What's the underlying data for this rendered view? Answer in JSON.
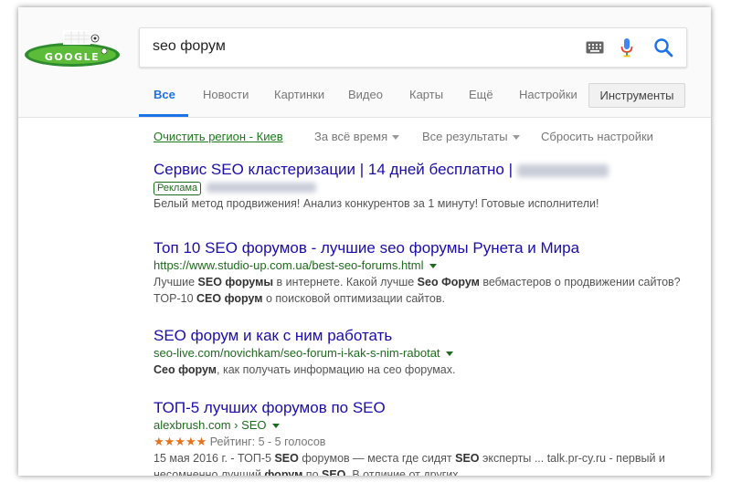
{
  "search": {
    "query": "seo форум"
  },
  "tabs": [
    {
      "label": "Все",
      "active": true
    },
    {
      "label": "Новости"
    },
    {
      "label": "Картинки"
    },
    {
      "label": "Видео"
    },
    {
      "label": "Карты"
    },
    {
      "label": "Ещё"
    },
    {
      "label": "Настройки"
    }
  ],
  "tools_button": "Инструменты",
  "toolsbar": {
    "region": "Очистить регион - Киев",
    "time": "За всё время",
    "results": "Все результаты",
    "reset": "Сбросить настройки"
  },
  "results": [
    {
      "title": "Сервис SEO кластеризации | 14 дней бесплатно |",
      "ad_badge": "Реклама",
      "snippet": "Белый метод продвижения! Анализ конкурентов за 1 минуту! Готовые исполнители!"
    },
    {
      "title_a": "Топ 10 SEO форумов",
      "title_b": " - лучшие seo форумы Рунета и Мира",
      "url": "https://www.studio-up.com.ua/best-seo-forums.html",
      "snip1_a": "Лучшие ",
      "snip1_b": "SEO форумы",
      "snip1_c": " в интернете. Какой лучше ",
      "snip1_d": "Seo Форум",
      "snip1_e": " вебмастеров о продвижении сайтов?",
      "snip2_a": "TOP-10 ",
      "snip2_b": "СЕО форум",
      "snip2_c": " о поисковой оптимизации сайтов."
    },
    {
      "title": "SEO форум и как с ним работать",
      "url": "seo-live.com/novichkam/seo-forum-i-kak-s-nim-rabotat",
      "snip_a": "Сео форум",
      "snip_b": ", как получать информацию на сео форумах."
    },
    {
      "title": "ТОП-5 лучших форумов по SEO",
      "url": "alexbrush.com › SEO",
      "stars": "★★★★★",
      "rating": "Рейтинг: 5 - 5 голосов",
      "snip1_a": "15 мая 2016 г. - ТОП-5 ",
      "snip1_b": "SEO",
      "snip1_c": " форумов — места где сидят ",
      "snip1_d": "SEO",
      "snip1_e": " эксперты ... talk.pr-cy.ru - первый и",
      "snip2_a": "несомненно лучший ",
      "snip2_b": "форум",
      "snip2_c": " по ",
      "snip2_d": "SEO",
      "snip2_e": ". В отличие от других ..."
    }
  ],
  "colors": {
    "link": "#1a0dab",
    "url_green": "#1e6b1e",
    "accent_blue": "#1a73e8",
    "star": "#e7711b"
  },
  "icons": [
    "google-doodle-logo",
    "keyboard-icon",
    "mic-icon",
    "search-icon"
  ]
}
